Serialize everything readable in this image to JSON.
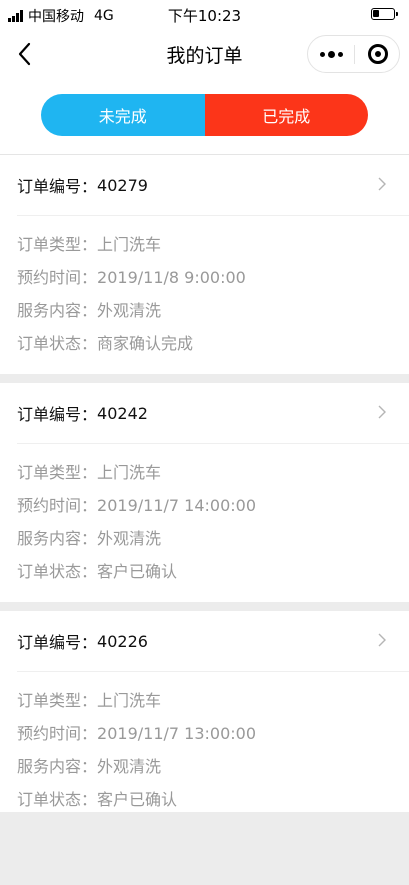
{
  "status_bar": {
    "carrier": "中国移动",
    "network": "4G",
    "time": "下午10:23",
    "battery_level": 0.3
  },
  "nav": {
    "title": "我的订单",
    "back_icon": "chevron-left-icon",
    "more_icon": "more-dots-icon",
    "close_icon": "target-circle-icon"
  },
  "tabs": [
    {
      "label": "未完成",
      "color": "#1fb5f1"
    },
    {
      "label": "已完成",
      "color": "#fc3519",
      "active": true
    }
  ],
  "labels": {
    "order_no": "订单编号",
    "type": "订单类型",
    "time": "预约时间",
    "service": "服务内容",
    "status": "订单状态",
    "separator": "："
  },
  "orders": [
    {
      "id": "40279",
      "type": "上门洗车",
      "time": "2019/11/8 9:00:00",
      "service": "外观清洗",
      "status": "商家确认完成"
    },
    {
      "id": "40242",
      "type": "上门洗车",
      "time": "2019/11/7 14:00:00",
      "service": "外观清洗",
      "status": "客户已确认"
    },
    {
      "id": "40226",
      "type": "上门洗车",
      "time": "2019/11/7 13:00:00",
      "service": "外观清洗",
      "status": "客户已确认"
    }
  ]
}
